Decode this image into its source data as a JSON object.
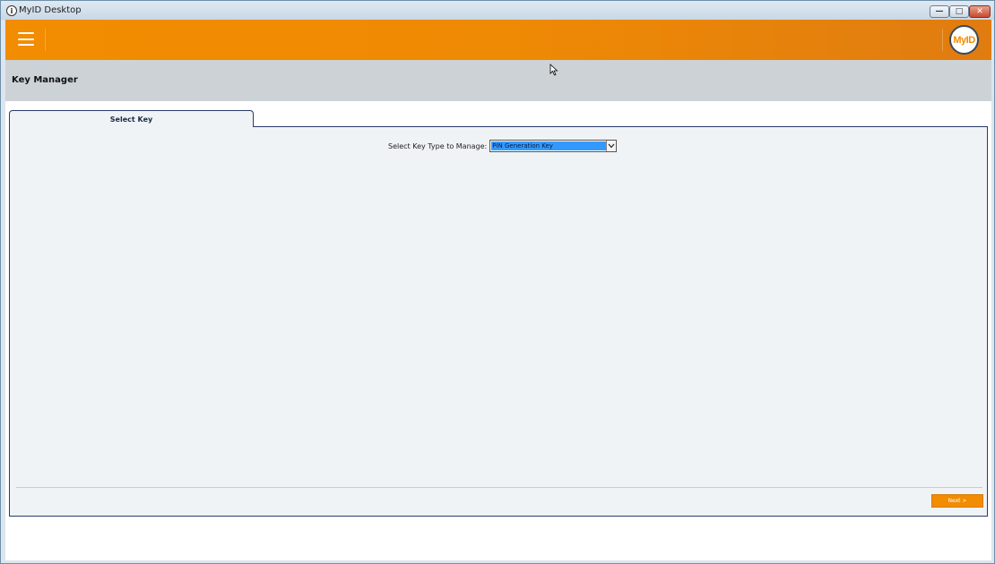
{
  "window": {
    "title": "MyID Desktop",
    "controls": {
      "minimize": "—",
      "maximize": "□",
      "close": "✕"
    }
  },
  "header": {
    "menu_icon": "hamburger-menu-icon",
    "logo_text": "MyID",
    "accent_color": "#f28c00"
  },
  "page": {
    "title": "Key Manager"
  },
  "tabs": [
    {
      "label": "Select Key",
      "active": true
    }
  ],
  "form": {
    "key_type_label": "Select Key Type to Manage:",
    "key_type_value": "PIN Generation Key",
    "dropdown_arrow": "⌄"
  },
  "actions": {
    "next_label": "Next >"
  }
}
